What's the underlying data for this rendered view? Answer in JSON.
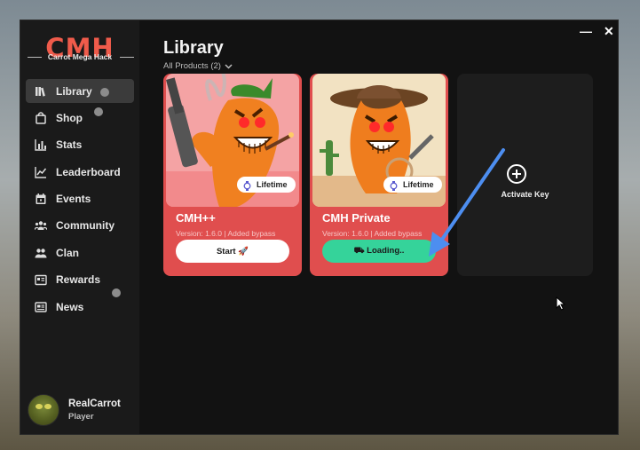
{
  "sidebar": {
    "logo": "CMH",
    "subtitle": "Carrot Mega Hack",
    "items": [
      {
        "label": "Library",
        "icon": "library-icon"
      },
      {
        "label": "Shop",
        "icon": "shopping-bag-icon"
      },
      {
        "label": "Stats",
        "icon": "bar-chart-icon"
      },
      {
        "label": "Leaderboard",
        "icon": "trend-chart-icon"
      },
      {
        "label": "Events",
        "icon": "calendar-icon"
      },
      {
        "label": "Community",
        "icon": "community-icon"
      },
      {
        "label": "Clan",
        "icon": "people-icon"
      },
      {
        "label": "Rewards",
        "icon": "gift-icon"
      },
      {
        "label": "News",
        "icon": "newspaper-icon"
      }
    ],
    "active": "Library"
  },
  "user": {
    "name": "RealCarrot",
    "role": "Player"
  },
  "window_controls": {
    "minimize": "—",
    "close": "✕"
  },
  "main": {
    "title": "Library",
    "filter": "All Products (2)"
  },
  "products": [
    {
      "name": "CMH++",
      "meta": "Version: 1.6.0 | Added bypass",
      "badge": "Lifetime",
      "button": "Start 🚀"
    },
    {
      "name": "CMH Private",
      "meta": "Version: 1.6.0 | Added bypass",
      "badge": "Lifetime",
      "button": "⛟ Loading.."
    }
  ],
  "activate": {
    "label": "Activate Key"
  },
  "colors": {
    "accent": "#ef5b4b",
    "card": "#e04e4e",
    "loading": "#35d39a",
    "annotation_arrow": "#4d8ef0"
  }
}
